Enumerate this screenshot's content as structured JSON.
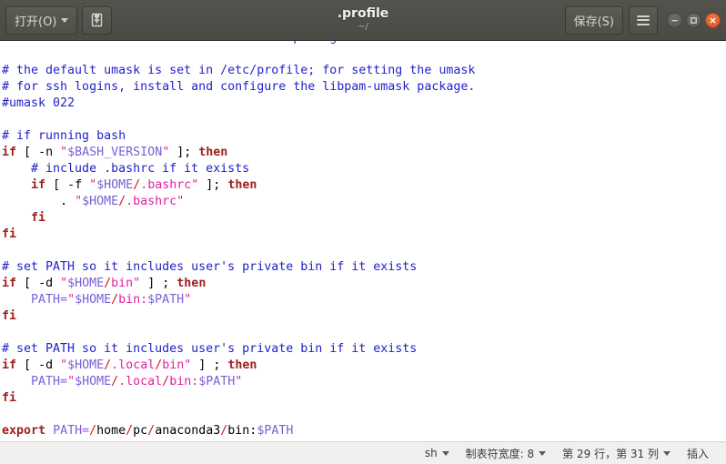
{
  "window": {
    "title": ".profile",
    "subtitle": "~/",
    "open_button_label": "打开(O)",
    "new_doc_icon": "new-document-icon",
    "save_button_label": "保存(S)",
    "menu_icon": "hamburger-menu-icon",
    "minimize_icon": "minimize-icon",
    "maximize_icon": "maximize-icon",
    "close_icon": "close-icon",
    "titlebar_color": "#4e4d47",
    "close_button_color": "#e8602c"
  },
  "editor": {
    "language": "sh",
    "lines": [
      {
        "id": 1,
        "text": "# the files are located in the bash-doc package.",
        "clipped": true
      },
      {
        "id": 2,
        "text": ""
      },
      {
        "id": 3,
        "text": "# the default umask is set in /etc/profile; for setting the umask"
      },
      {
        "id": 4,
        "text": "# for ssh logins, install and configure the libpam-umask package."
      },
      {
        "id": 5,
        "text": "#umask 022"
      },
      {
        "id": 6,
        "text": ""
      },
      {
        "id": 7,
        "text": "# if running bash"
      },
      {
        "id": 8,
        "text": "if [ -n \"$BASH_VERSION\" ]; then"
      },
      {
        "id": 9,
        "text": "    # include .bashrc if it exists"
      },
      {
        "id": 10,
        "text": "    if [ -f \"$HOME/.bashrc\" ]; then"
      },
      {
        "id": 11,
        "text": "        . \"$HOME/.bashrc\""
      },
      {
        "id": 12,
        "text": "    fi"
      },
      {
        "id": 13,
        "text": "fi"
      },
      {
        "id": 14,
        "text": ""
      },
      {
        "id": 15,
        "text": "# set PATH so it includes user's private bin if it exists"
      },
      {
        "id": 16,
        "text": "if [ -d \"$HOME/bin\" ] ; then"
      },
      {
        "id": 17,
        "text": "    PATH=\"$HOME/bin:$PATH\""
      },
      {
        "id": 18,
        "text": "fi"
      },
      {
        "id": 19,
        "text": ""
      },
      {
        "id": 20,
        "text": "# set PATH so it includes user's private bin if it exists"
      },
      {
        "id": 21,
        "text": "if [ -d \"$HOME/.local/bin\" ] ; then"
      },
      {
        "id": 22,
        "text": "    PATH=\"$HOME/.local/bin:$PATH\""
      },
      {
        "id": 23,
        "text": "fi"
      },
      {
        "id": 24,
        "text": ""
      },
      {
        "id": 25,
        "text": "export PATH=/home/pc/anaconda3/bin:$PATH"
      }
    ],
    "colors": {
      "comment": "#2222cc",
      "keyword": "#a02020",
      "string": "#e020a0",
      "variable": "#7b5fd6",
      "slash": "#d81414",
      "plain": "#000000",
      "background": "#ffffff"
    }
  },
  "statusbar": {
    "language_label": "sh",
    "tab_width_label": "制表符宽度: 8",
    "cursor_position_label": "第 29 行，第 31 列",
    "insert_mode_label": "插入"
  }
}
